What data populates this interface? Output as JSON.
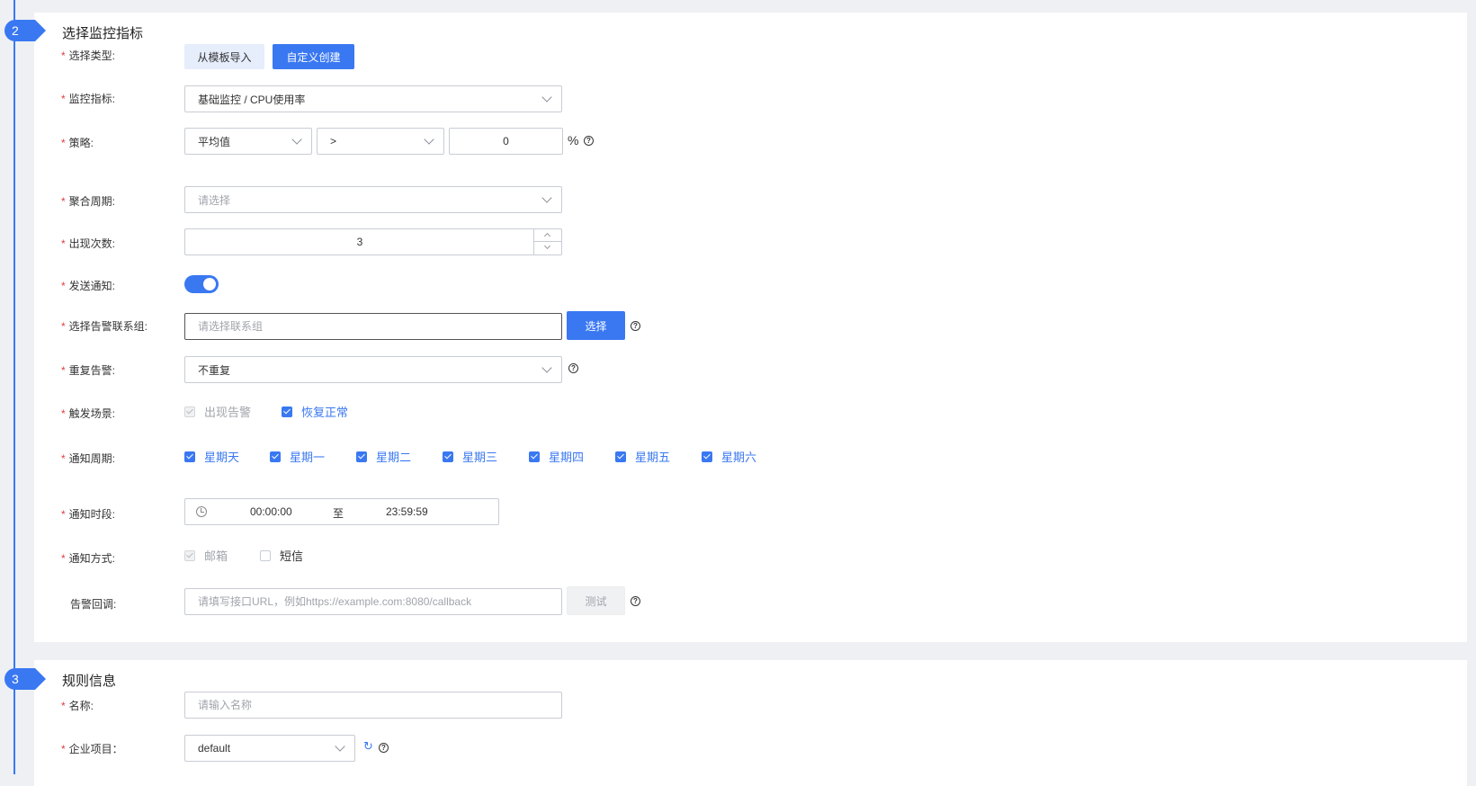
{
  "section2": {
    "number": "2",
    "title": "选择监控指标",
    "type_label": "选择类型:",
    "type_options": [
      "从模板导入",
      "自定义创建"
    ],
    "metric_label": "监控指标:",
    "metric_value": "基础监控 / CPU使用率",
    "strategy_label": "策略:",
    "strategy_agg": "平均值",
    "strategy_op": ">",
    "strategy_threshold": "0",
    "strategy_unit": "%",
    "period_label": "聚合周期:",
    "period_placeholder": "请选择",
    "count_label": "出现次数:",
    "count_value": "3",
    "notify_label": "发送通知:",
    "notify_enabled": true,
    "group_label": "选择告警联系组:",
    "group_placeholder": "请选择联系组",
    "group_button": "选择",
    "repeat_label": "重复告警:",
    "repeat_value": "不重复",
    "trigger_label": "触发场景:",
    "trigger_options": [
      {
        "label": "出现告警",
        "state": "checked-disabled"
      },
      {
        "label": "恢复正常",
        "state": "checked"
      }
    ],
    "week_label": "通知周期:",
    "week_days": [
      "星期天",
      "星期一",
      "星期二",
      "星期三",
      "星期四",
      "星期五",
      "星期六"
    ],
    "time_label": "通知时段:",
    "time_start": "00:00:00",
    "time_sep": "至",
    "time_end": "23:59:59",
    "method_label": "通知方式:",
    "method_options": [
      {
        "label": "邮箱",
        "state": "checked-disabled"
      },
      {
        "label": "短信",
        "state": "unchecked"
      }
    ],
    "callback_label": "告警回调:",
    "callback_placeholder": "请填写接口URL，例如https://example.com:8080/callback",
    "callback_test_button": "测试"
  },
  "section3": {
    "number": "3",
    "title": "规则信息",
    "name_label": "名称:",
    "name_placeholder": "请输入名称",
    "project_label": "企业项目：",
    "project_value": "default"
  },
  "colors": {
    "accent": "#3a78f2",
    "required": "#e03e3e",
    "background": "#eef0f4"
  },
  "icons": {
    "help": "?",
    "refresh": "↻"
  }
}
